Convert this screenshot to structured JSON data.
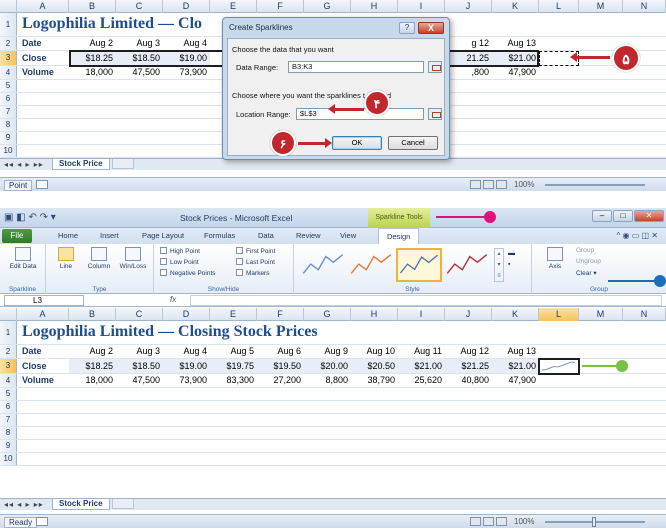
{
  "top": {
    "title": "Logophilia Limited — Clo",
    "columns": [
      "A",
      "B",
      "C",
      "D",
      "E",
      "F",
      "G",
      "H",
      "I",
      "J",
      "K",
      "L",
      "M",
      "N"
    ],
    "rows": [
      "1",
      "2",
      "3",
      "4",
      "5",
      "6",
      "7",
      "8",
      "9",
      "10"
    ],
    "row_labels": [
      "Date",
      "Close",
      "Volume"
    ],
    "dates_left": [
      "Aug 2",
      "Aug 3",
      "Aug 4"
    ],
    "dates_right": [
      "g 12",
      "Aug 13"
    ],
    "close_left": [
      "$18.25",
      "$18.50",
      "$19.00"
    ],
    "close_right": [
      "21.25",
      "$21.00"
    ],
    "volume_left": [
      "18,000",
      "47,500",
      "73,900"
    ],
    "volume_right": [
      ",800",
      "47,900"
    ],
    "sheet_tab": "Stock Price",
    "status_mode": "Point",
    "zoom": "100%",
    "dialog": {
      "title": "Create Sparklines",
      "help": "?",
      "close": "X",
      "section1": "Choose the data that you want",
      "data_range_label": "Data Range:",
      "data_range_value": "B3:K3",
      "section2": "Choose where you want the sparklines t",
      "section2_tail": "ced",
      "location_label": "Location Range:",
      "location_value": "$L$3",
      "ok": "OK",
      "cancel": "Cancel"
    },
    "callouts": {
      "five": "۵",
      "four": "۴",
      "six": "۶"
    }
  },
  "bottom": {
    "window_title": "Stock Prices - Microsoft Excel",
    "context_tab": "Sparkline Tools",
    "file": "File",
    "menus": [
      "Home",
      "Insert",
      "Page Layout",
      "Formulas",
      "Data",
      "Review",
      "View",
      "Design"
    ],
    "groups": {
      "sparkline": "Sparkline",
      "type": "Type",
      "showhide": "Show/Hide",
      "style": "Style",
      "group": "Group"
    },
    "buttons": {
      "edit_data": "Edit Data",
      "line": "Line",
      "column": "Column",
      "winloss": "Win/Loss",
      "axis": "Axis",
      "group": "Group",
      "ungroup": "Ungroup",
      "clear": "Clear"
    },
    "checks": [
      "High Point",
      "Low Point",
      "Negative Points",
      "First Point",
      "Last Point",
      "Markers"
    ],
    "name_box": "L3",
    "fx": "fx",
    "title": "Logophilia Limited — Closing Stock Prices",
    "columns": [
      "A",
      "B",
      "C",
      "D",
      "E",
      "F",
      "G",
      "H",
      "I",
      "J",
      "K",
      "L",
      "M",
      "N"
    ],
    "rows": [
      "1",
      "2",
      "3",
      "4",
      "5",
      "6",
      "7",
      "8",
      "9",
      "10"
    ],
    "row_labels": [
      "Date",
      "Close",
      "Volume"
    ],
    "dates": [
      "Aug 2",
      "Aug 3",
      "Aug 4",
      "Aug 5",
      "Aug 6",
      "Aug 9",
      "Aug 10",
      "Aug 11",
      "Aug 12",
      "Aug 13"
    ],
    "close": [
      "$18.25",
      "$18.50",
      "$19.00",
      "$19.75",
      "$19.50",
      "$20.00",
      "$20.50",
      "$21.00",
      "$21.25",
      "$21.00"
    ],
    "volume": [
      "18,000",
      "47,500",
      "73,900",
      "83,300",
      "27,200",
      "8,800",
      "38,790",
      "25,620",
      "40,800",
      "47,900"
    ],
    "sheet_tab": "Stock Price",
    "status_mode": "Ready",
    "zoom": "100%"
  },
  "colors": {
    "accent_red": "#c1272d",
    "accent_magenta": "#e0117c",
    "accent_blue": "#1b6fb8",
    "accent_green": "#7ac043",
    "title_blue": "#1f4e8c"
  }
}
